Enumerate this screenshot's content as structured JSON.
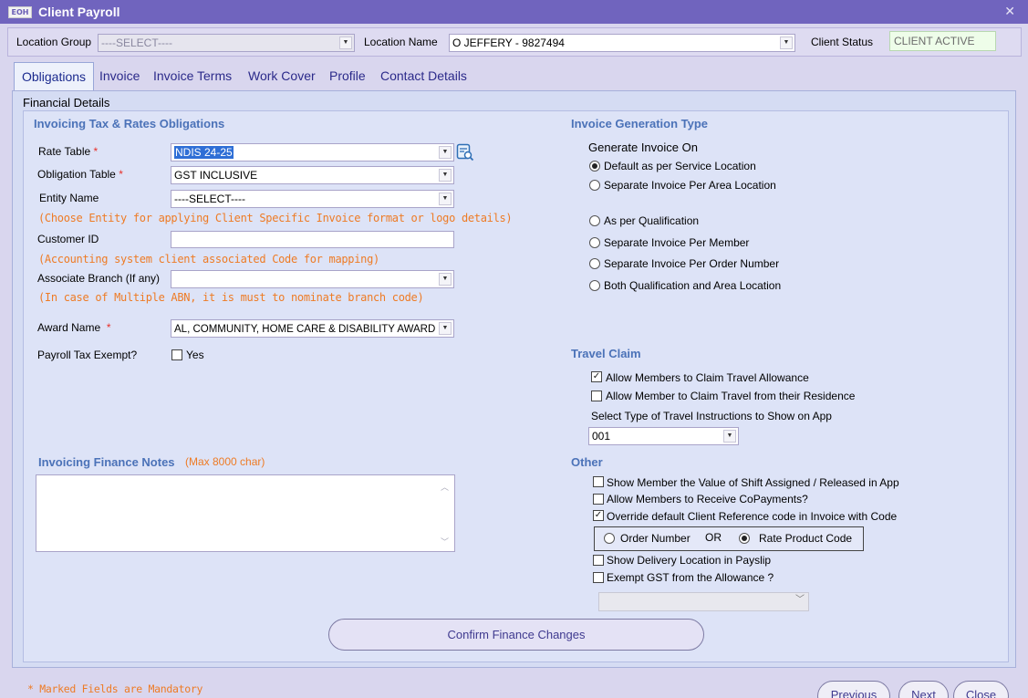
{
  "window": {
    "title": "Client Payroll",
    "logo_text": "EOH",
    "close_glyph": "✕"
  },
  "location_bar": {
    "location_group_label": "Location Group",
    "location_group_value": "----SELECT----",
    "location_name_label": "Location Name",
    "location_name_value": "O JEFFERY - 9827494",
    "client_status_label": "Client Status",
    "client_status_value": "CLIENT ACTIVE"
  },
  "tabs": [
    "Obligations",
    "Invoice",
    "Invoice Terms",
    "Work Cover",
    "Profile",
    "Contact Details"
  ],
  "financial_details_label": "Financial Details",
  "tax_rates": {
    "title": "Invoicing Tax & Rates Obligations",
    "rate_table_label": "Rate Table",
    "rate_table_value": "NDIS 24-25",
    "obligation_table_label": "Obligation Table",
    "obligation_table_value": "GST INCLUSIVE",
    "entity_name_label": "Entity Name",
    "entity_name_value": "----SELECT----",
    "entity_hint": "(Choose Entity for applying Client Specific Invoice format or logo details)",
    "customer_id_label": "Customer ID",
    "customer_id_value": "",
    "customer_id_hint": "(Accounting system client associated Code for mapping)",
    "associate_branch_label": "Associate Branch (If any)",
    "associate_branch_value": "",
    "branch_hint": "(In case of Multiple ABN, it is must to nominate branch code)",
    "award_name_label": "Award Name",
    "award_name_value": "AL, COMMUNITY, HOME CARE & DISABILITY AWARD",
    "payroll_tax_label": "Payroll Tax Exempt?",
    "payroll_tax_option": "Yes",
    "payroll_tax_checked": false,
    "required_marker": "*"
  },
  "finance_notes": {
    "title": "Invoicing Finance Notes",
    "max_hint": "(Max 8000 char)",
    "value": ""
  },
  "invoice_generation": {
    "title": "Invoice Generation Type",
    "subtitle": "Generate Invoice On",
    "options": [
      {
        "label": "Default as per Service Location",
        "selected": true
      },
      {
        "label": "Separate Invoice Per Area Location",
        "selected": false
      },
      {
        "label": "As per Qualification",
        "selected": false
      },
      {
        "label": "Separate Invoice Per Member",
        "selected": false
      },
      {
        "label": "Separate Invoice Per Order Number",
        "selected": false
      },
      {
        "label": "Both Qualification and Area Location",
        "selected": false
      }
    ]
  },
  "travel_claim": {
    "title": "Travel Claim",
    "options": [
      {
        "label": "Allow Members to Claim Travel Allowance",
        "checked": true
      },
      {
        "label": "Allow Member to Claim Travel from their Residence",
        "checked": false
      }
    ],
    "instructions_label": "Select Type of Travel Instructions to Show on App",
    "instructions_value": "001"
  },
  "other": {
    "title": "Other",
    "options": [
      {
        "label": "Show Member the Value of Shift Assigned / Released in App",
        "checked": false
      },
      {
        "label": "Allow Members to Receive CoPayments?",
        "checked": false
      },
      {
        "label": "Override default Client Reference code in Invoice with Code",
        "checked": true
      },
      {
        "label": "Show Delivery Location in Payslip",
        "checked": false
      },
      {
        "label": "Exempt GST from the Allowance ?",
        "checked": false
      }
    ],
    "ref_code": {
      "order_number_label": "Order Number",
      "or_label": "OR",
      "rate_product_label": "Rate Product Code",
      "selected": "rate_product"
    },
    "allowance_select_value": ""
  },
  "buttons": {
    "confirm": "Confirm Finance Changes",
    "previous": "Previous",
    "next": "Next",
    "close": "Close"
  },
  "footer_note": "* Marked Fields are Mandatory"
}
